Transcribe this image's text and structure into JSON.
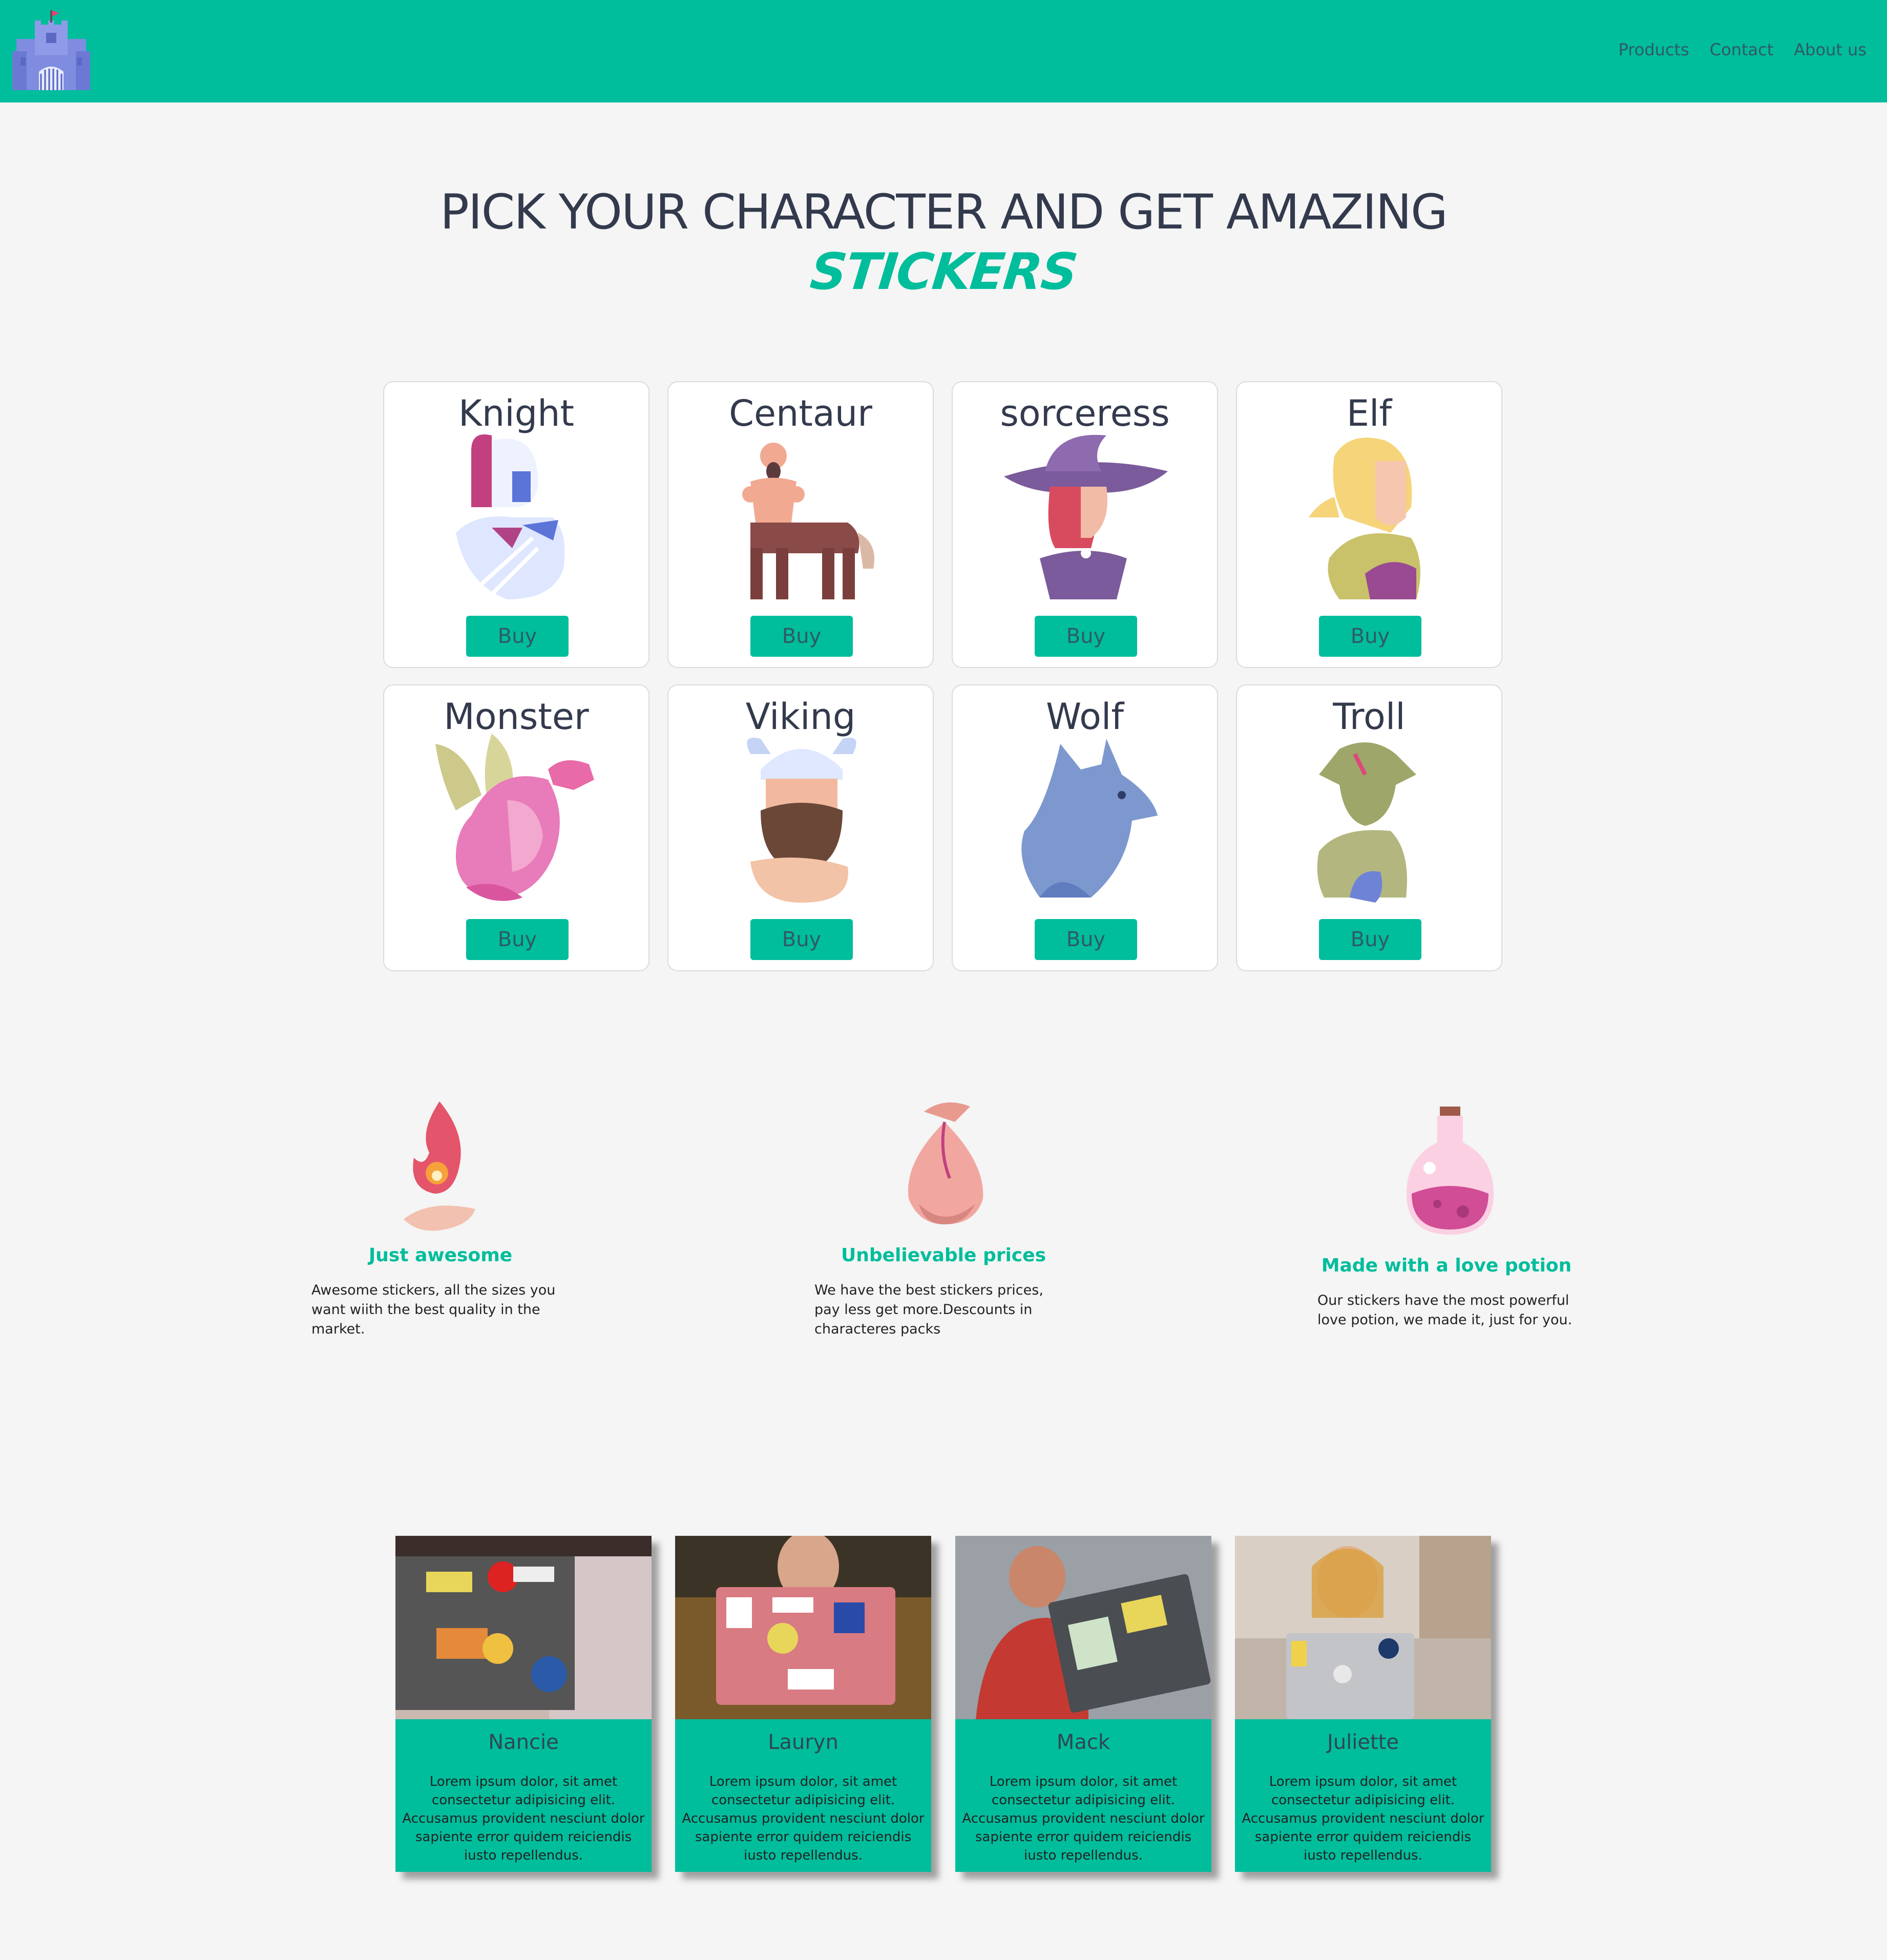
{
  "header": {
    "logo_icon": "castle-icon",
    "nav": [
      "Products",
      "Contact",
      "About us"
    ],
    "brand_color": "#00bd9c"
  },
  "hero": {
    "title_line1": "PICK YOUR CHARACTER AND GET AMAZING",
    "title_line2": "STICKERS"
  },
  "characters": [
    {
      "name": "Knight",
      "icon": "knight-icon",
      "buy_label": "Buy"
    },
    {
      "name": "Centaur",
      "icon": "centaur-icon",
      "buy_label": "Buy"
    },
    {
      "name": "sorceress",
      "icon": "sorceress-icon",
      "buy_label": "Buy"
    },
    {
      "name": "Elf",
      "icon": "elf-icon",
      "buy_label": "Buy"
    },
    {
      "name": "Monster",
      "icon": "dragon-icon",
      "buy_label": "Buy"
    },
    {
      "name": "Viking",
      "icon": "viking-icon",
      "buy_label": "Buy"
    },
    {
      "name": "Wolf",
      "icon": "wolf-icon",
      "buy_label": "Buy"
    },
    {
      "name": "Troll",
      "icon": "troll-icon",
      "buy_label": "Buy"
    }
  ],
  "features": [
    {
      "icon": "fire-hand-icon",
      "title": "Just awesome",
      "text": "Awesome stickers, all the sizes you want wiith the best quality in the market."
    },
    {
      "icon": "money-bag-icon",
      "title": "Unbelievable prices",
      "text": "We have the best stickers prices, pay less get more.Descounts in characteres packs"
    },
    {
      "icon": "potion-icon",
      "title": "Made with a love potion",
      "text": "Our stickers have the most powerful love potion, we made it, just for you."
    }
  ],
  "testimonials": [
    {
      "name": "Nancie",
      "photo": "laptop-stickers-photo",
      "text": "Lorem ipsum dolor, sit amet consectetur adipisicing elit. Accusamus provident nesciunt dolor sapiente error quidem reiciendis iusto repellendus."
    },
    {
      "name": "Lauryn",
      "photo": "laptop-stickers-photo",
      "text": "Lorem ipsum dolor, sit amet consectetur adipisicing elit. Accusamus provident nesciunt dolor sapiente error quidem reiciendis iusto repellendus."
    },
    {
      "name": "Mack",
      "photo": "laptop-stickers-photo",
      "text": "Lorem ipsum dolor, sit amet consectetur adipisicing elit. Accusamus provident nesciunt dolor sapiente error quidem reiciendis iusto repellendus."
    },
    {
      "name": "Juliette",
      "photo": "laptop-stickers-photo",
      "text": "Lorem ipsum dolor, sit amet consectetur adipisicing elit. Accusamus provident nesciunt dolor sapiente error quidem reiciendis iusto repellendus."
    }
  ]
}
